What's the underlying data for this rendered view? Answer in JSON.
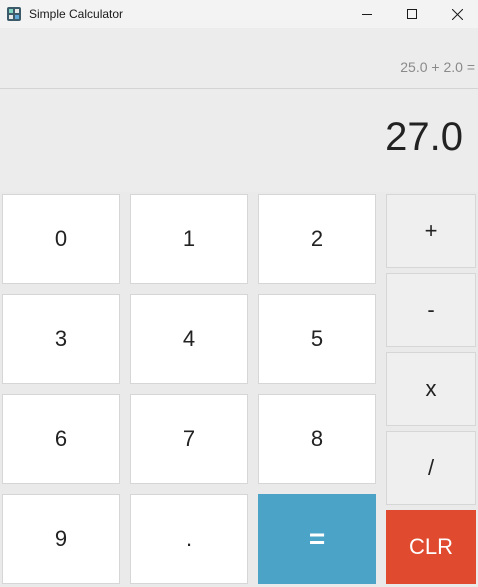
{
  "window": {
    "title": "Simple Calculator",
    "icon": "calculator-app-icon",
    "controls": [
      "minimize-icon",
      "maximize-icon",
      "close-icon"
    ]
  },
  "display": {
    "expression": "25.0 + 2.0 =",
    "result": "27.0"
  },
  "keypad": {
    "k0": "0",
    "k1": "1",
    "k2": "2",
    "k3": "3",
    "k4": "4",
    "k5": "5",
    "k6": "6",
    "k7": "7",
    "k8": "8",
    "k9": "9",
    "decimal": ".",
    "equals": "="
  },
  "operators": {
    "add": "+",
    "subtract": "-",
    "multiply": "x",
    "divide": "/",
    "clear": "CLR"
  },
  "colors": {
    "equals_bg": "#4ba3c7",
    "clear_bg": "#e04a2f",
    "digit_bg": "#ffffff",
    "operator_bg": "#efefef",
    "window_bg": "#eaeaea"
  }
}
